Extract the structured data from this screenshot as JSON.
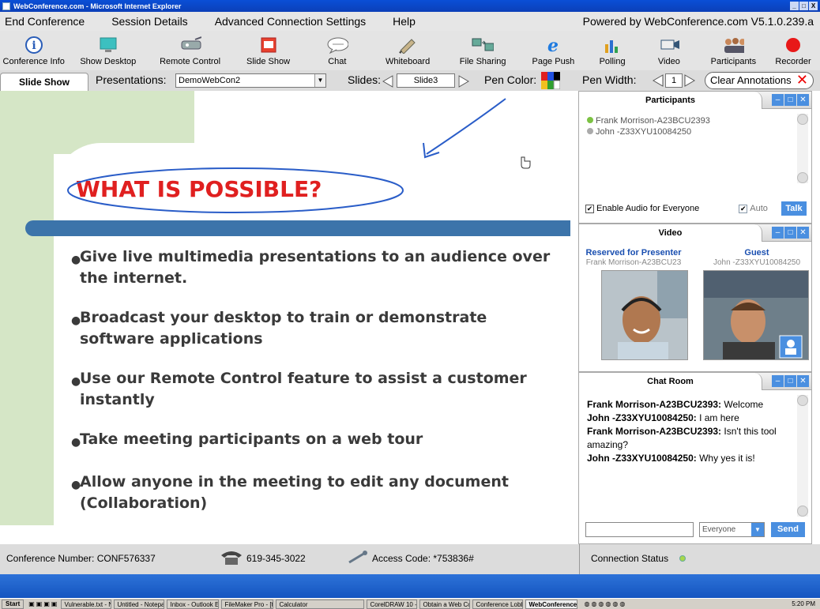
{
  "window": {
    "title": "WebConference.com - Microsoft Internet Explorer",
    "controls": [
      "_",
      "□",
      "X"
    ]
  },
  "menu": {
    "items": [
      "End Conference",
      "Session Details",
      "Advanced Connection Settings",
      "Help"
    ],
    "powered_by": "Powered by WebConference.com  V5.1.0.239.a"
  },
  "toolbar": {
    "tools": [
      {
        "label": "Conference Info",
        "icon": "info-icon"
      },
      {
        "label": "Show Desktop",
        "icon": "monitor-icon"
      },
      {
        "label": "Remote Control",
        "icon": "remote-control-icon"
      },
      {
        "label": "Slide Show",
        "icon": "slideshow-icon"
      },
      {
        "label": "Chat",
        "icon": "chat-bubble-icon"
      },
      {
        "label": "Whiteboard",
        "icon": "whiteboard-icon"
      },
      {
        "label": "File Sharing",
        "icon": "file-sharing-icon"
      },
      {
        "label": "Page Push",
        "icon": "ie-icon"
      },
      {
        "label": "Polling",
        "icon": "polling-icon"
      },
      {
        "label": "Video",
        "icon": "video-icon"
      },
      {
        "label": "Participants",
        "icon": "participants-icon"
      },
      {
        "label": "Recorder",
        "icon": "record-icon"
      }
    ]
  },
  "controls": {
    "tab": "Slide Show",
    "presentations_label": "Presentations:",
    "presentation_value": "DemoWebCon2",
    "slides_label": "Slides:",
    "slide_value": "Slide3",
    "pen_color_label": "Pen Color:",
    "pen_width_label": "Pen Width:",
    "pen_width_value": "1",
    "clear_annotations": "Clear Annotations",
    "clear_icon": "✕"
  },
  "slide": {
    "headline": "WHAT IS POSSIBLE?",
    "bullets": [
      "Give live multimedia presentations to an audience over the internet.",
      "Broadcast your desktop to train or demonstrate software applications",
      "Use our Remote Control feature to assist a customer instantly",
      "Take meeting participants on a web tour",
      "Allow anyone in the meeting to edit any document (Collaboration)"
    ],
    "colors": {
      "green": "#d5e6c6",
      "bar": "#3c74aa",
      "headline": "#e02020"
    }
  },
  "participants": {
    "title": "Participants",
    "list": [
      {
        "name": "Frank Morrison-A23BCU2393",
        "status_color": "#7cc243"
      },
      {
        "name": "John -Z33XYU10084250",
        "status_color": "#aaaaaa"
      }
    ],
    "enable_audio": "Enable Audio for Everyone",
    "auto": "Auto",
    "talk": "Talk"
  },
  "video": {
    "title": "Video",
    "presenter_label": "Reserved for Presenter",
    "presenter_name": "Frank Morrison-A23BCU23",
    "guest_label": "Guest",
    "guest_name": "John -Z33XYU10084250"
  },
  "chat": {
    "title": "Chat Room",
    "messages": [
      {
        "sender": "Frank Morrison-A23BCU2393:",
        "text": "Welcome"
      },
      {
        "sender": "John -Z33XYU10084250:",
        "text": "I am here"
      },
      {
        "sender": "Frank Morrison-A23BCU2393:",
        "text": "Isn't this tool amazing?"
      },
      {
        "sender": "John -Z33XYU10084250:",
        "text": "Why yes it is!"
      }
    ],
    "input_value": "",
    "recipient": "Everyone",
    "send": "Send"
  },
  "status": {
    "conference_number": "Conference Number: CONF576337",
    "phone": "619-345-3022",
    "access_code": "Access Code: *753836#",
    "connection": "Connection Status"
  },
  "taskbar": {
    "start": "Start",
    "tasks": [
      "Vulnerable.txt - N...",
      "Untitled - Notepad",
      "Inbox - Outlook Ex...",
      "FileMaker Pro - [tr...",
      "Calculator",
      "CorelDRAW 10 - [...",
      "Obtain a Web Con...",
      "Conference Lobby...",
      "WebConference..."
    ],
    "active_task": 8,
    "clock": "5:20 PM"
  }
}
